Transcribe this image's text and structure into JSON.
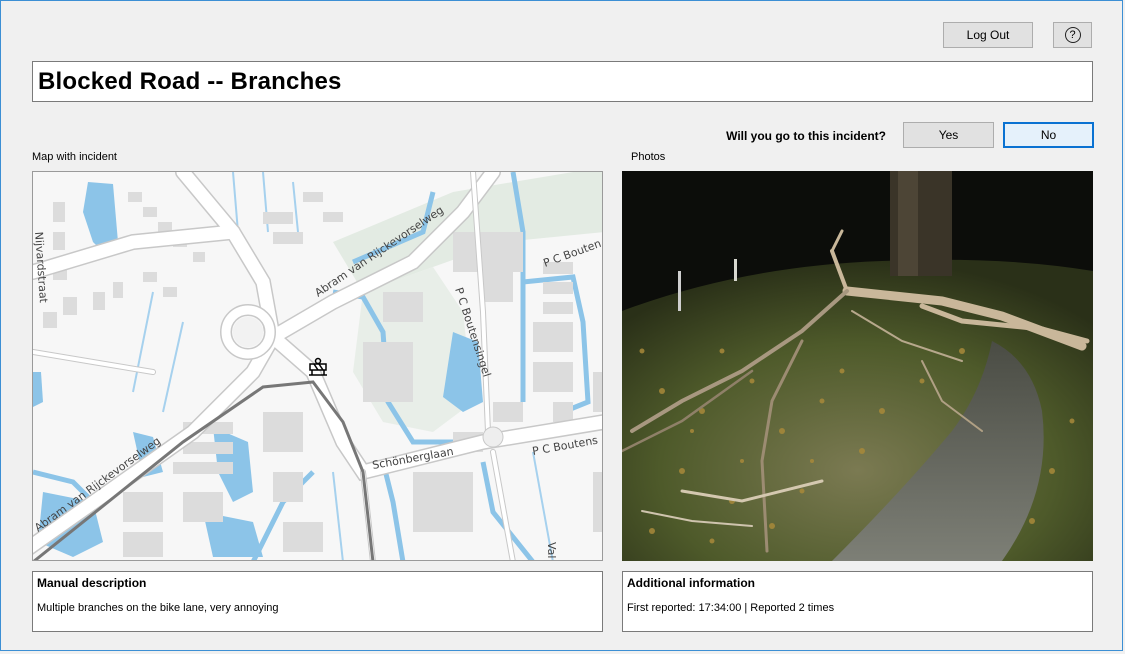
{
  "header": {
    "logout_label": "Log Out",
    "help_symbol": "?"
  },
  "incident": {
    "title": "Blocked Road -- Branches"
  },
  "prompt": {
    "question": "Will you go to this incident?",
    "yes_label": "Yes",
    "no_label": "No"
  },
  "map": {
    "label": "Map with incident",
    "marker_icon": "roadblock-icon",
    "street_labels": {
      "abram_upper": "Abram van Rijckevorselweg",
      "abram_lower": "Abram van Rijckevorselweg",
      "boutensingel": "P C Boutensingel",
      "boutens_top": "P C Bouten",
      "boutens_right": "P C Boutens",
      "schonberglaan": "Schönberglaan",
      "left_straat": "Nijvardstraat",
      "val": "Val"
    }
  },
  "photos": {
    "label": "Photos"
  },
  "manual_description": {
    "title": "Manual description",
    "text": "Multiple branches on the bike lane, very annoying"
  },
  "additional_info": {
    "title": "Additional information",
    "text": "First reported: 17:34:00 | Reported 2 times"
  },
  "colors": {
    "accent": "#0a72d2",
    "water": "#8cc4e8",
    "building": "#dcdcdc"
  }
}
